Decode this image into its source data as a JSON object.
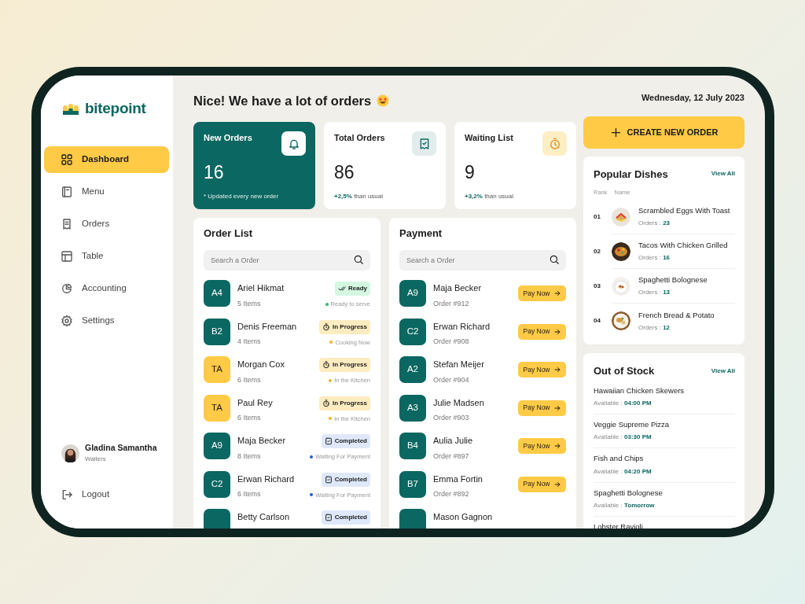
{
  "sidebar": {
    "logo": "bitepoint",
    "items": [
      {
        "label": "Dashboard",
        "selected": true
      },
      {
        "label": "Menu",
        "selected": false
      },
      {
        "label": "Orders",
        "selected": false
      },
      {
        "label": "Table",
        "selected": false
      },
      {
        "label": "Accounting",
        "selected": false
      },
      {
        "label": "Settings",
        "selected": false
      }
    ],
    "user": {
      "name": "Gladina Samantha",
      "role": "Waiters"
    },
    "logout": "Logout"
  },
  "header": {
    "title": "Nice! We have a lot of orders",
    "date": "Wednesday, 12 July 2023"
  },
  "stats": [
    {
      "title": "New Orders",
      "value": "16",
      "note": "* Updated every new order",
      "highlighted": true
    },
    {
      "title": "Total Orders",
      "value": "86",
      "note": "**+2,5%** than usual",
      "highlighted": false
    },
    {
      "title": "Waiting List",
      "value": "9",
      "note": "**+3,2%** than usual",
      "highlighted": false
    }
  ],
  "create_button": "CREATE NEW ORDER",
  "order_list": {
    "title": "Order List",
    "placeholder": "Search a Order",
    "orders": [
      {
        "code": "A4",
        "color": "#0b6761",
        "name": "Ariel Hikmat",
        "items": "5 Items",
        "kind": "ready",
        "badge": "Ready",
        "note": "Ready to serve"
      },
      {
        "code": "B2",
        "color": "#0b6761",
        "name": "Denis Freeman",
        "items": "4 Items",
        "kind": "progress",
        "badge": "In Progress",
        "note": "Cooking Now"
      },
      {
        "code": "TA",
        "color": "#ffca45",
        "name": "Morgan Cox",
        "items": "6 Items",
        "kind": "progress",
        "badge": "In Progress",
        "note": "In the Kitchen"
      },
      {
        "code": "TA",
        "color": "#ffca45",
        "name": "Paul Rey",
        "items": "6 Items",
        "kind": "progress",
        "badge": "In Progress",
        "note": "In the Kitchen"
      },
      {
        "code": "A9",
        "color": "#0b6761",
        "name": "Maja Becker",
        "items": "8 Items",
        "kind": "completed",
        "badge": "Completed",
        "note": "Waiting For Payment"
      },
      {
        "code": "C2",
        "color": "#0b6761",
        "name": "Erwan Richard",
        "items": "6 Items",
        "kind": "completed",
        "badge": "Completed",
        "note": "Waiting For Payment"
      },
      {
        "color": "#0b6761",
        "name": "Betty Carlson",
        "kind": "completed",
        "badge": "Completed"
      }
    ]
  },
  "payment": {
    "title": "Payment",
    "placeholder": "Search a Order",
    "rows": [
      {
        "code": "A9",
        "name": "Maja Becker",
        "order": "Order #912",
        "button": "Pay Now"
      },
      {
        "code": "C2",
        "name": "Erwan Richard",
        "order": "Order #908",
        "button": "Pay Now"
      },
      {
        "code": "A2",
        "name": "Stefan Meijer",
        "order": "Order #904",
        "button": "Pay Now"
      },
      {
        "code": "A3",
        "name": "Julie Madsen",
        "order": "Order #903",
        "button": "Pay Now"
      },
      {
        "code": "B4",
        "name": "Aulia Julie",
        "order": "Order #897",
        "button": "Pay Now"
      },
      {
        "code": "B7",
        "name": "Emma Fortin",
        "order": "Order #892",
        "button": "Pay Now"
      },
      {
        "name": "Mason Gagnon"
      }
    ]
  },
  "popular": {
    "title": "Popular Dishes",
    "view_all": "View All",
    "columns": [
      "Rank",
      "Name"
    ],
    "dishes": [
      {
        "rank": "01",
        "name": "Scrambled Eggs With Toast",
        "orders": "Orders : **23**"
      },
      {
        "rank": "02",
        "name": "Tacos With Chicken Grilled",
        "orders": "Orders : **16**"
      },
      {
        "rank": "03",
        "name": "Spaghetti Bolognese",
        "orders": "Orders : **13**"
      },
      {
        "rank": "04",
        "name": "French Bread & Potato",
        "orders": "Orders : **12**"
      }
    ]
  },
  "out_of_stock": {
    "title": "Out of Stock",
    "view_all": "View All",
    "items": [
      {
        "name": "Hawaiian Chicken Skewers",
        "available": "Available : **04:00 PM**"
      },
      {
        "name": "Veggie Supreme Pizza",
        "available": "Available : **03:30 PM**"
      },
      {
        "name": "Fish and Chips",
        "available": "Available : **04:20 PM**"
      },
      {
        "name": "Spaghetti Bolognese",
        "available": "Available : **Tomorrow**"
      },
      {
        "name": "Lobster Ravioli"
      }
    ]
  }
}
